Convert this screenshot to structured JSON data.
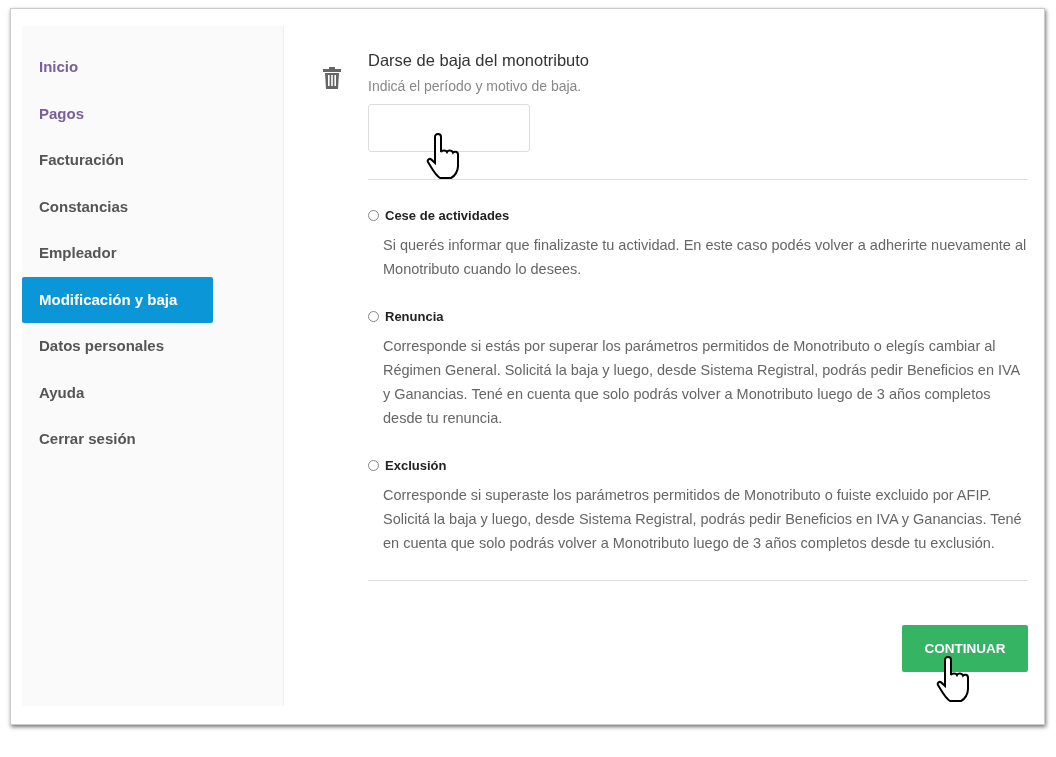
{
  "sidebar": {
    "items": [
      {
        "label": "Inicio",
        "selected": false,
        "visited": true
      },
      {
        "label": "Pagos",
        "selected": false,
        "visited": true
      },
      {
        "label": "Facturación",
        "selected": false,
        "visited": false
      },
      {
        "label": "Constancias",
        "selected": false,
        "visited": false
      },
      {
        "label": "Empleador",
        "selected": false,
        "visited": false
      },
      {
        "label": "Modificación y baja",
        "selected": true,
        "visited": false
      },
      {
        "label": "Datos personales",
        "selected": false,
        "visited": false
      },
      {
        "label": "Ayuda",
        "selected": false,
        "visited": false
      },
      {
        "label": "Cerrar sesión",
        "selected": false,
        "visited": false
      }
    ]
  },
  "form": {
    "title": "Darse de baja del monotributo",
    "subtitle": "Indicá el período y motivo de baja.",
    "options": [
      {
        "label": "Cese de actividades",
        "selected": false,
        "description": "Si querés informar que finalizaste tu actividad. En este caso podés volver a adherirte nuevamente al Monotributo cuando lo desees."
      },
      {
        "label": "Renuncia",
        "selected": false,
        "description": "Corresponde si estás por superar los parámetros permitidos de Monotributo o elegís cambiar al Régimen General. Solicitá la baja y luego, desde Sistema Registral, podrás pedir Beneficios en IVA y Ganancias. Tené en cuenta que solo podrás volver a Monotributo luego de 3 años completos desde tu renuncia."
      },
      {
        "label": "Exclusión",
        "selected": false,
        "description": "Corresponde si superaste los parámetros permitidos de Monotributo o fuiste excluido por AFIP. Solicitá la baja y luego, desde Sistema Registral, podrás pedir Beneficios en IVA y Ganancias. Tené en cuenta que solo podrás volver a Monotributo luego de 3 años completos desde tu exclusión."
      }
    ],
    "button": "CONTINUAR"
  }
}
